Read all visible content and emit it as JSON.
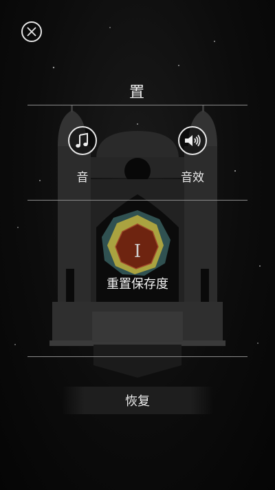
{
  "header": {
    "close_icon": "close-icon",
    "title": "置"
  },
  "audio": {
    "music": {
      "icon": "music-note-icon",
      "label": "音"
    },
    "sound_effects": {
      "icon": "speaker-icon",
      "label": "音效"
    }
  },
  "save": {
    "emblem_icon": "level-emblem-icon",
    "emblem_numeral": "I",
    "label": "重置保存度"
  },
  "footer": {
    "restore_label": "恢复"
  },
  "colors": {
    "background": "#0c0c0c",
    "foreground": "#e8e8e8",
    "emblem_red": "#6e2410",
    "emblem_yellow": "#c9b83c",
    "emblem_teal": "#3e6a6a"
  }
}
